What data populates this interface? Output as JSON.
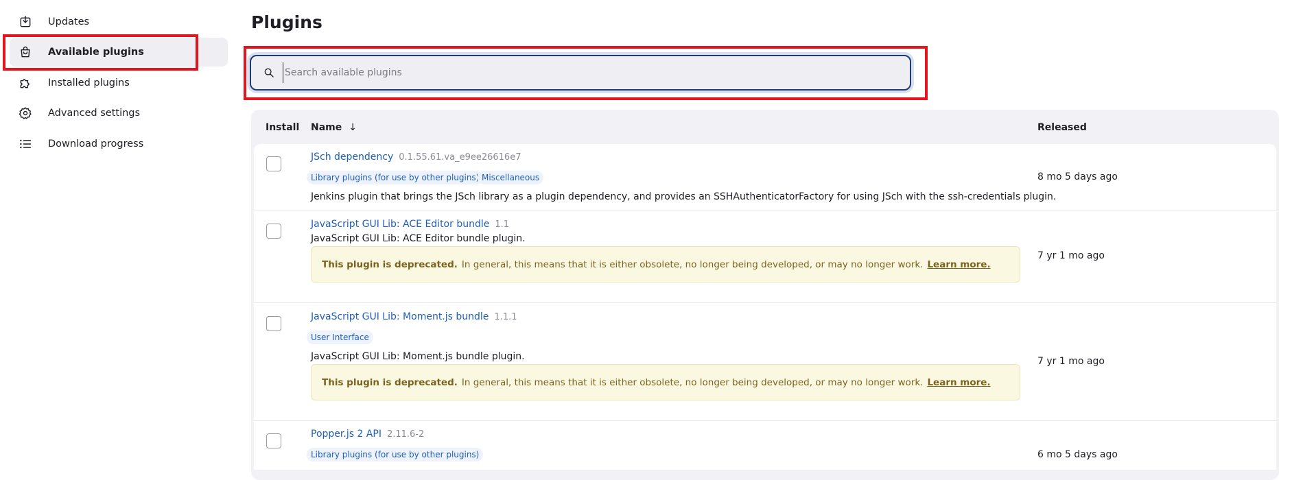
{
  "sidebar": {
    "items": [
      {
        "label": "Updates",
        "icon": "download-icon"
      },
      {
        "label": "Available plugins",
        "icon": "shopping-bag-icon",
        "active": true
      },
      {
        "label": "Installed plugins",
        "icon": "puzzle-icon"
      },
      {
        "label": "Advanced settings",
        "icon": "gear-icon"
      },
      {
        "label": "Download progress",
        "icon": "list-icon"
      }
    ]
  },
  "main": {
    "title": "Plugins",
    "search": {
      "placeholder": "Search available plugins",
      "value": ""
    },
    "table": {
      "headers": {
        "install": "Install",
        "name": "Name",
        "sort_arrow": "↓",
        "released": "Released"
      },
      "rows": [
        {
          "name": "JSch dependency",
          "version": "0.1.55.61.va_e9ee26616e7",
          "tags": [
            "Library plugins (for use by other plugins)",
            "Miscellaneous"
          ],
          "description": "Jenkins plugin that brings the JSch library as a plugin dependency, and provides an SSHAuthenticatorFactory for using JSch with the ssh-credentials plugin.",
          "released": "8 mo 5 days ago"
        },
        {
          "name": "JavaScript GUI Lib: ACE Editor bundle",
          "version": "1.1",
          "description": "JavaScript GUI Lib: ACE Editor bundle plugin.",
          "deprecated": {
            "strong": "This plugin is deprecated.",
            "text": "In general, this means that it is either obsolete, no longer being developed, or may no longer work.",
            "link": "Learn more."
          },
          "released": "7 yr 1 mo ago"
        },
        {
          "name": "JavaScript GUI Lib: Moment.js bundle",
          "version": "1.1.1",
          "tags": [
            "User Interface"
          ],
          "description": "JavaScript GUI Lib: Moment.js bundle plugin.",
          "deprecated": {
            "strong": "This plugin is deprecated.",
            "text": "In general, this means that it is either obsolete, no longer being developed, or may no longer work.",
            "link": "Learn more."
          },
          "released": "7 yr 1 mo ago"
        },
        {
          "name": "Popper.js 2 API",
          "version": "2.11.6-2",
          "tags": [
            "Library plugins (for use by other plugins)"
          ],
          "released": "6 mo 5 days ago"
        }
      ]
    }
  },
  "colors": {
    "highlight": "#e3161f",
    "link": "#1f5fb8",
    "warning_bg": "#fbf8e1"
  }
}
